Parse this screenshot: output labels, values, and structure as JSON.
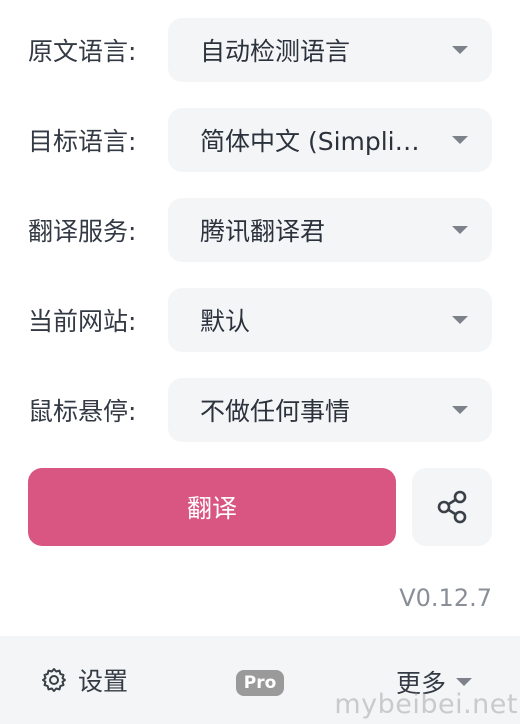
{
  "fields": [
    {
      "label": "原文语言:",
      "value": "自动检测语言"
    },
    {
      "label": "目标语言:",
      "value": "简体中文 (Simplified Chinese)"
    },
    {
      "label": "翻译服务:",
      "value": "腾讯翻译君"
    },
    {
      "label": "当前网站:",
      "value": "默认"
    },
    {
      "label": "鼠标悬停:",
      "value": "不做任何事情"
    }
  ],
  "actions": {
    "translate_label": "翻译",
    "share_icon": "share-icon"
  },
  "version": "V0.12.7",
  "footer": {
    "settings_label": "设置",
    "settings_icon": "gear-icon",
    "pro_badge": "Pro",
    "more_label": "更多"
  },
  "watermark": "mybeibei.net",
  "colors": {
    "accent": "#d85681",
    "field_bg": "#f4f5f7",
    "footer_bg": "#f4f5f7",
    "pro_badge_bg": "#9a9a9a"
  }
}
